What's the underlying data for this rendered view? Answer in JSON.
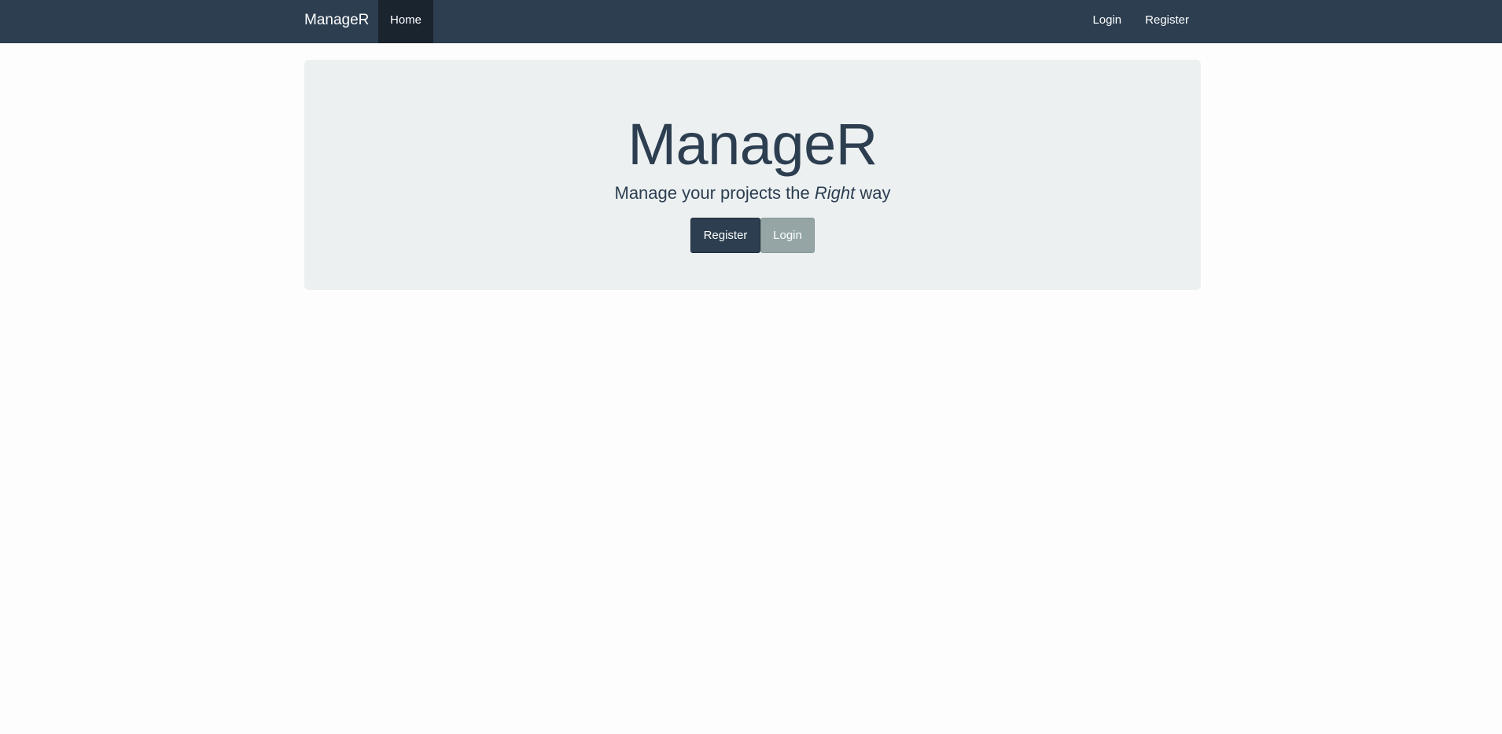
{
  "navbar": {
    "brand": "ManageR",
    "home_label": "Home",
    "login_label": "Login",
    "register_label": "Register"
  },
  "hero": {
    "title": "ManageR",
    "subtitle_before": "Manage your projects the ",
    "subtitle_emphasis": "Right",
    "subtitle_after": " way",
    "register_button": "Register",
    "login_button": "Login"
  },
  "colors": {
    "navbar_bg": "#2c3e50",
    "navbar_active_bg": "#1a242f",
    "jumbotron_bg": "#ecf0f1",
    "primary": "#2c3e50",
    "secondary": "#95a5a6"
  }
}
